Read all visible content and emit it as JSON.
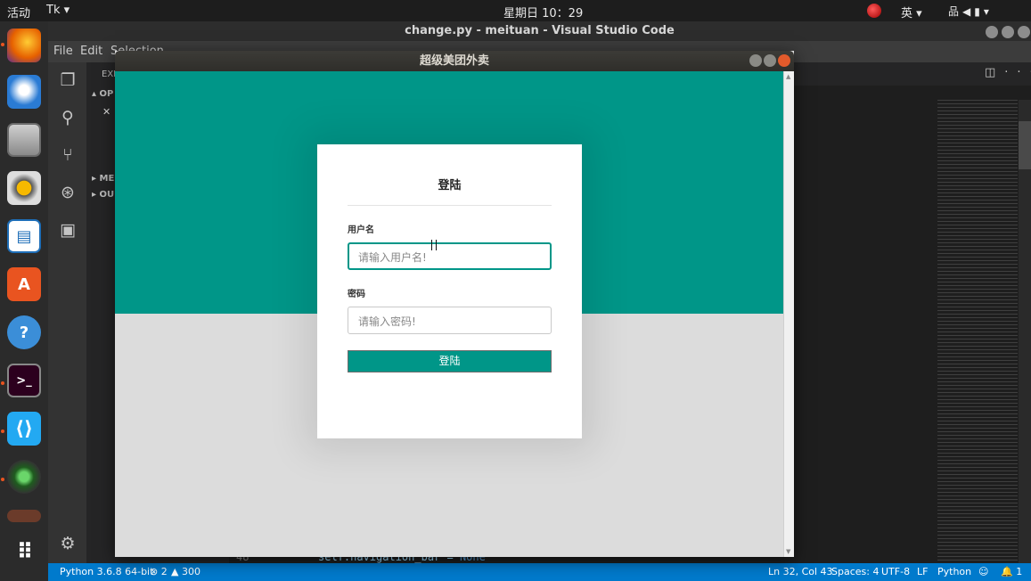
{
  "system": {
    "activities": "活动",
    "app_menu": "Tk ▾",
    "clock": "星期日 10：29",
    "input_method": "英 ▾",
    "tray_icons": [
      "network-icon",
      "volume-icon",
      "battery-icon",
      "power-menu-icon"
    ]
  },
  "dock": {
    "apps": [
      "firefox-icon",
      "thunderbird-icon",
      "files-icon",
      "rhythmbox-icon",
      "writer-icon",
      "software-center-icon",
      "help-icon",
      "terminal-icon",
      "vscode-icon",
      "camera-icon",
      "trash-icon",
      "show-apps-icon"
    ]
  },
  "vscode": {
    "window_title": "change.py - meituan - Visual Studio Code",
    "menu": {
      "file": "File",
      "edit": "Edit",
      "selection": "Selection"
    },
    "sidebar": {
      "explorer": "EXP",
      "open_editors": "OP",
      "close_marker": "✕",
      "section_me": "ME",
      "section_out": "OU"
    },
    "code": {
      "line_number": "48",
      "text": "self.navigation_bar = ",
      "keyword": "None"
    },
    "status": {
      "python": "Python 3.6.8 64-bit",
      "errors": "⊗ 2",
      "warnings": "▲ 300",
      "cursor": "Ln 32, Col 43",
      "spaces": "Spaces: 4",
      "encoding": "UTF-8",
      "eol": "LF",
      "language": "Python",
      "notifications": "🔔 1"
    }
  },
  "tk_app": {
    "window_title": "超级美团外卖",
    "login": {
      "title": "登陆",
      "username_label": "用户名",
      "username_placeholder": "请输入用户名!",
      "password_label": "密码",
      "password_placeholder": "请输入密码!",
      "submit_label": "登陆"
    },
    "colors": {
      "accent": "#009688",
      "background": "#dcdcdc",
      "card": "#ffffff"
    }
  }
}
